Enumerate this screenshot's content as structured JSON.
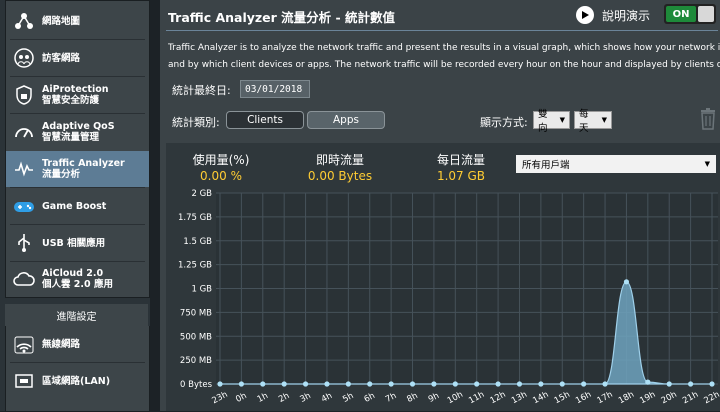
{
  "sidebar": {
    "items": [
      {
        "label1": "網路地圖",
        "label2": "",
        "icon": "network-map-icon"
      },
      {
        "label1": "訪客網路",
        "label2": "",
        "icon": "guest-network-icon"
      },
      {
        "label1": "AiProtection",
        "label2": "智慧安全防護",
        "icon": "shield-icon"
      },
      {
        "label1": "Adaptive QoS",
        "label2": "智慧流量管理",
        "icon": "qos-gauge-icon"
      },
      {
        "label1": "Traffic Analyzer",
        "label2": "流量分析",
        "icon": "traffic-analyzer-icon"
      },
      {
        "label1": "Game Boost",
        "label2": "",
        "icon": "gamepad-icon"
      },
      {
        "label1": "USB 相關應用",
        "label2": "",
        "icon": "usb-icon"
      },
      {
        "label1": "AiCloud 2.0",
        "label2": "個人雲 2.0 應用",
        "icon": "cloud-icon"
      }
    ],
    "advanced_header": "進階設定",
    "advanced_items": [
      {
        "label": "無線網路",
        "icon": "wifi-icon"
      },
      {
        "label": "區域網路(LAN)",
        "icon": "lan-icon"
      }
    ]
  },
  "header": {
    "title": "Traffic Analyzer 流量分析 - 統計數值",
    "help_label": "說明演示",
    "toggle_label": "ON"
  },
  "description": {
    "line1": "Traffic Analyzer is to analyze the network traffic and present the results in a visual graph, which shows how your network is use",
    "line2": "and by which client devices or apps. The network traffic will be recorded every hour on the hour and displayed by clients or app"
  },
  "filters": {
    "date_label": "統計最終日:",
    "date_value": "03/01/2018",
    "type_label": "統計類別:",
    "clients_label": "Clients",
    "apps_label": "Apps",
    "mode_label": "顯示方式:",
    "direction_value": "雙向",
    "period_value": "每天"
  },
  "stats": {
    "usage_label": "使用量(%)",
    "usage_value": "0.00 %",
    "realtime_label": "即時流量",
    "realtime_value": "0.00 Bytes",
    "daily_label": "每日流量",
    "daily_value": "1.07 GB",
    "client_select": "所有用戶端"
  },
  "chart_data": {
    "type": "area",
    "y_ticks": [
      "2 GB",
      "1.75 GB",
      "1.5 GB",
      "1.25 GB",
      "1 GB",
      "750 MB",
      "500 MB",
      "250 MB",
      "0 Bytes"
    ],
    "ylim_gb": [
      0,
      2
    ],
    "x_labels": [
      "23h",
      "0h",
      "1h",
      "2h",
      "3h",
      "4h",
      "5h",
      "6h",
      "7h",
      "8h",
      "9h",
      "10h",
      "11h",
      "12h",
      "13h",
      "14h",
      "15h",
      "16h",
      "17h",
      "18h",
      "19h",
      "20h",
      "21h",
      "22h"
    ],
    "values_gb": [
      0,
      0,
      0,
      0,
      0,
      0,
      0,
      0,
      0,
      0,
      0,
      0,
      0,
      0,
      0,
      0,
      0,
      0,
      0,
      1.07,
      0.02,
      0,
      0,
      0
    ],
    "colors": {
      "fill": "#6fa3be",
      "line": "#9fd0ea",
      "point": "#aee0f6"
    }
  }
}
